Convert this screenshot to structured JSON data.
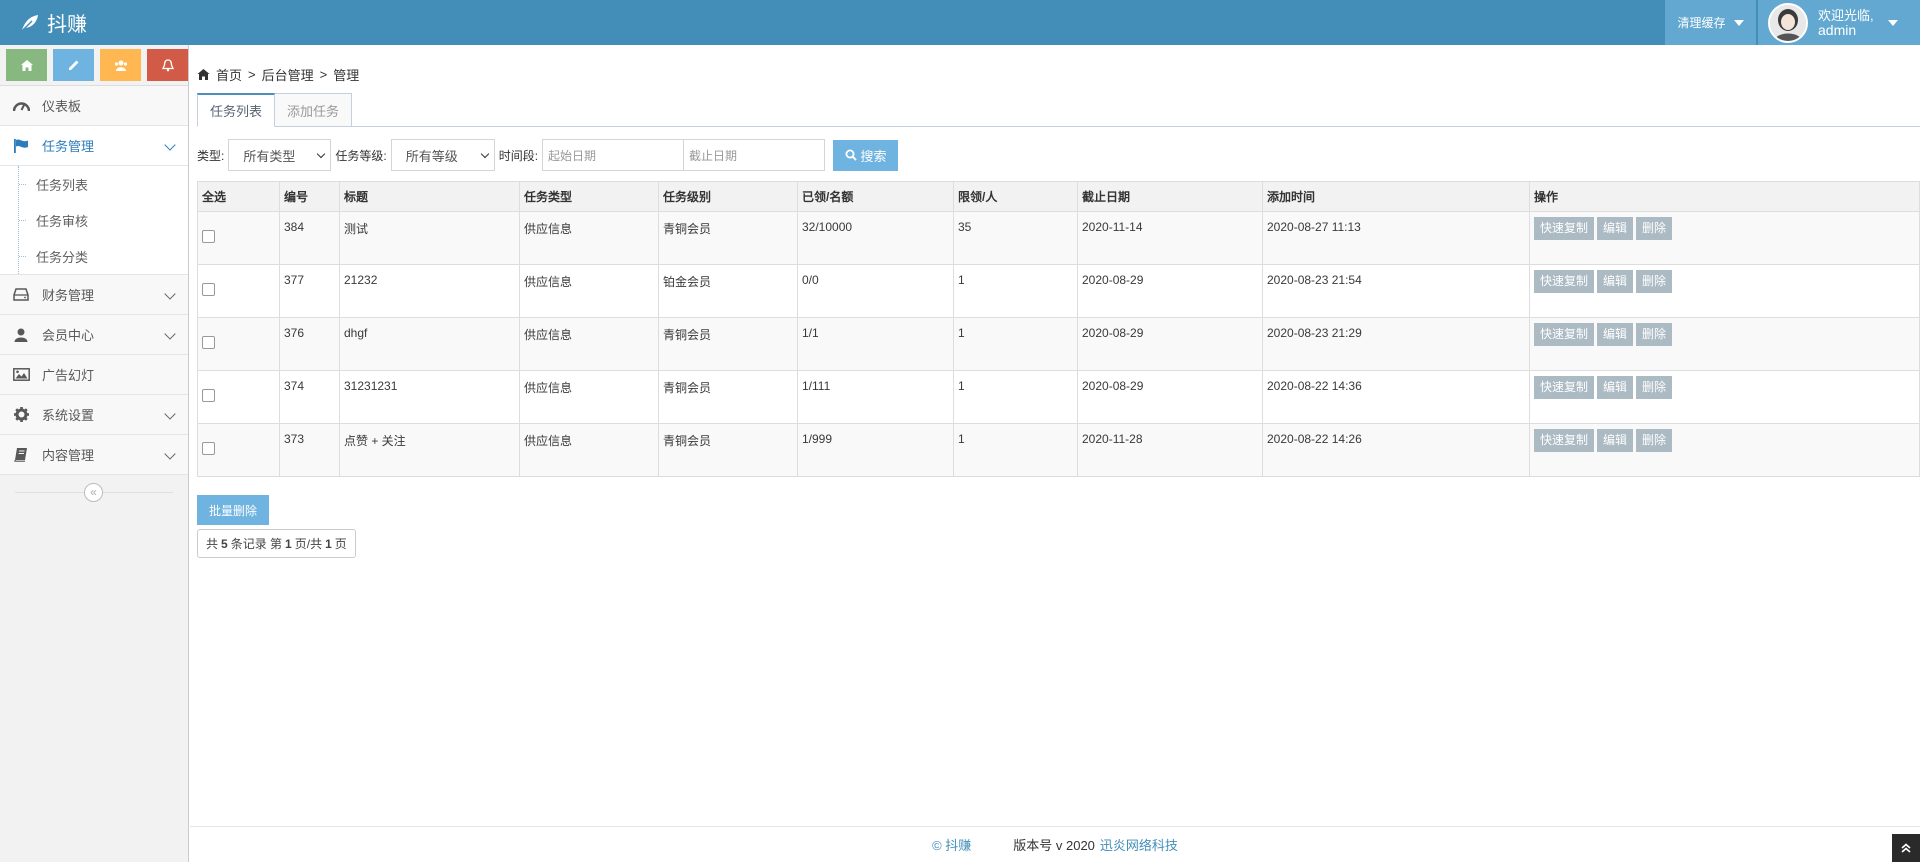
{
  "header": {
    "brand": "抖赚",
    "clear_cache": "清理缓存",
    "welcome": "欢迎光临,",
    "username": "admin"
  },
  "colors": {
    "navbar": "#438eb9",
    "accent": "#6fb3e0",
    "shortcut_green": "#87b87f",
    "shortcut_blue": "#6fb3e0",
    "shortcut_orange": "#ffb752",
    "shortcut_red": "#d15b47"
  },
  "shortcuts": [
    "home-icon",
    "pencil-icon",
    "users-icon",
    "bell-icon"
  ],
  "sidebar": {
    "items": [
      {
        "label": "仪表板",
        "icon": "dashboard-icon"
      },
      {
        "label": "任务管理",
        "icon": "flag-icon"
      },
      {
        "label": "财务管理",
        "icon": "hdd-icon"
      },
      {
        "label": "会员中心",
        "icon": "user-icon"
      },
      {
        "label": "广告幻灯",
        "icon": "picture-icon"
      },
      {
        "label": "系统设置",
        "icon": "gear-icon"
      },
      {
        "label": "内容管理",
        "icon": "book-icon"
      }
    ],
    "submenu": [
      "任务列表",
      "任务审核",
      "任务分类"
    ]
  },
  "breadcrumb": {
    "home": "首页",
    "sep": ">",
    "level2": "后台管理",
    "level3": "管理"
  },
  "tabs": [
    "任务列表",
    "添加任务"
  ],
  "filters": {
    "type_label": "类型:",
    "type_value": "所有类型",
    "level_label": "任务等级:",
    "level_value": "所有等级",
    "time_label": "时间段:",
    "start_placeholder": "起始日期",
    "end_placeholder": "截止日期",
    "search_label": "搜索"
  },
  "table": {
    "headers": [
      "全选",
      "编号",
      "标题",
      "任务类型",
      "任务级别",
      "已领/名额",
      "限领/人",
      "截止日期",
      "添加时间",
      "操作"
    ],
    "rows": [
      {
        "id": "384",
        "title": "测试",
        "type": "供应信息",
        "level": "青铜会员",
        "quota": "32/10000",
        "limit": "35",
        "deadline": "2020-11-14",
        "added": "2020-08-27 11:13"
      },
      {
        "id": "377",
        "title": "21232",
        "type": "供应信息",
        "level": "铂金会员",
        "quota": "0/0",
        "limit": "1",
        "deadline": "2020-08-29",
        "added": "2020-08-23 21:54"
      },
      {
        "id": "376",
        "title": "dhgf",
        "type": "供应信息",
        "level": "青铜会员",
        "quota": "1/1",
        "limit": "1",
        "deadline": "2020-08-29",
        "added": "2020-08-23 21:29"
      },
      {
        "id": "374",
        "title": "31231231",
        "type": "供应信息",
        "level": "青铜会员",
        "quota": "1/111",
        "limit": "1",
        "deadline": "2020-08-29",
        "added": "2020-08-22 14:36"
      },
      {
        "id": "373",
        "title": "点赞 + 关注",
        "type": "供应信息",
        "level": "青铜会员",
        "quota": "1/999",
        "limit": "1",
        "deadline": "2020-11-28",
        "added": "2020-08-22 14:26"
      }
    ],
    "actions": [
      "快速复制",
      "编辑",
      "删除"
    ]
  },
  "bulk_delete": "批量删除",
  "pager": {
    "prefix": "共",
    "total": "5",
    "mid": "条记录 第",
    "page": "1",
    "mid2": "页/共",
    "pages": "1",
    "suffix": "页"
  },
  "footer": {
    "copyright": "© 抖赚",
    "version": "版本号 v 2020",
    "company": "迅炎网络科技"
  }
}
